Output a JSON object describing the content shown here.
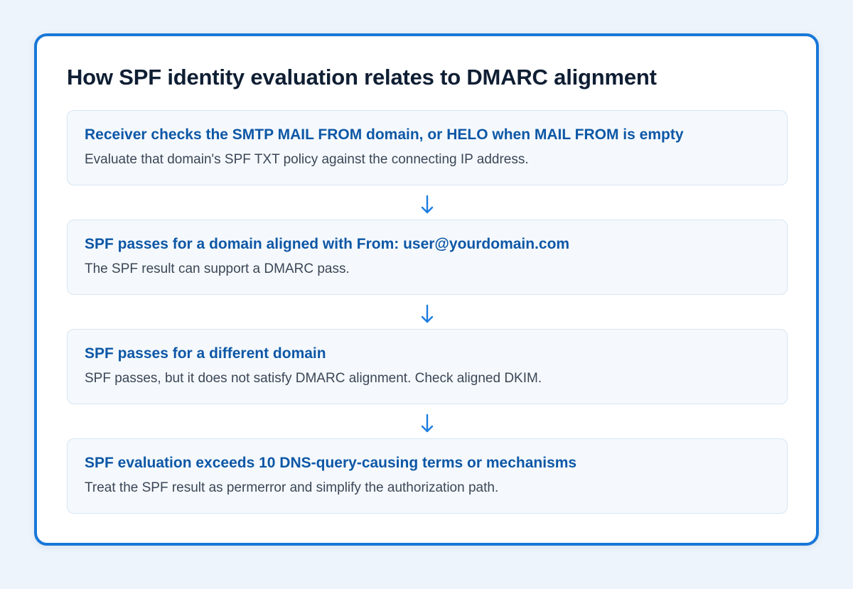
{
  "title": "How SPF identity evaluation relates to DMARC alignment",
  "steps": [
    {
      "title": "Receiver checks the SMTP MAIL FROM domain, or HELO when MAIL FROM is empty",
      "description": "Evaluate that domain's SPF TXT policy against the connecting IP address."
    },
    {
      "title": "SPF passes for a domain aligned with From: user@yourdomain.com",
      "description": "The SPF result can support a DMARC pass."
    },
    {
      "title": "SPF passes for a different domain",
      "description": "SPF passes, but it does not satisfy DMARC alignment. Check aligned DKIM."
    },
    {
      "title": "SPF evaluation exceeds 10 DNS-query-causing terms or mechanisms",
      "description": "Treat the SPF result as permerror and simplify the authorization path."
    }
  ],
  "colors": {
    "accent": "#1877d8",
    "step_title": "#0d57a6",
    "arrow": "#1a7de0",
    "title": "#0f1e33"
  },
  "icons": [
    "arrow-down-icon"
  ]
}
